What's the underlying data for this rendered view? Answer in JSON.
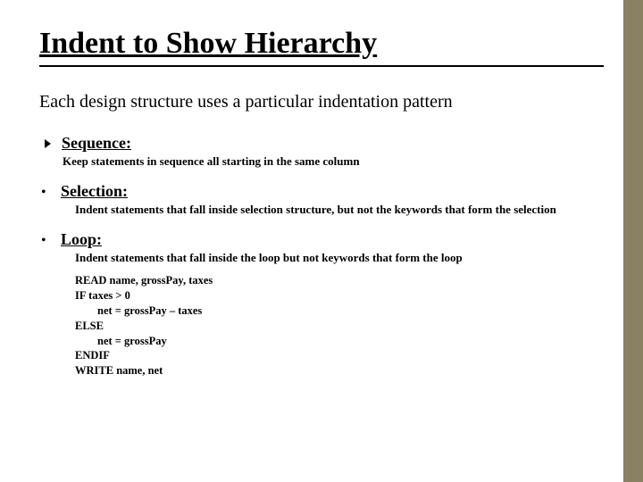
{
  "title": "Indent to Show Hierarchy",
  "intro": "Each design structure uses a particular indentation pattern",
  "sequence": {
    "heading": "Sequence:",
    "body": "Keep statements in sequence all starting in the same column"
  },
  "selection": {
    "heading": "Selection:",
    "body": "Indent statements that fall inside selection structure, but not the keywords that form the selection"
  },
  "loop": {
    "heading": "Loop:",
    "body": "Indent statements that fall inside the loop but not keywords that form the loop",
    "code": [
      "READ name, grossPay, taxes",
      "IF taxes > 0",
      "        net = grossPay – taxes",
      "ELSE",
      "        net = grossPay",
      "ENDIF",
      "WRITE name, net"
    ]
  }
}
